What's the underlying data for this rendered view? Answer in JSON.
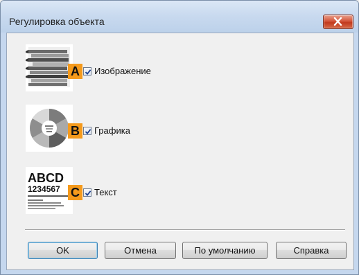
{
  "window": {
    "title": "Регулировка объекта"
  },
  "options": [
    {
      "letter": "A",
      "label": "Изображение",
      "checked": true,
      "thumbnail_icon": "photo-thumbnail-icon"
    },
    {
      "letter": "B",
      "label": "Графика",
      "checked": true,
      "thumbnail_icon": "donut-chart-thumbnail-icon"
    },
    {
      "letter": "C",
      "label": "Текст",
      "checked": true,
      "thumbnail_icon": "text-sample-thumbnail-icon"
    }
  ],
  "thumbnail_text": {
    "line1": "ABCD",
    "line2": "1234567"
  },
  "buttons": {
    "ok": "OK",
    "cancel": "Отмена",
    "defaults": "По умолчанию",
    "help": "Справка"
  },
  "colors": {
    "letter_badge": "#f59a1c",
    "close_button": "#c94a2c",
    "title_bar": "#c5d7ee"
  }
}
